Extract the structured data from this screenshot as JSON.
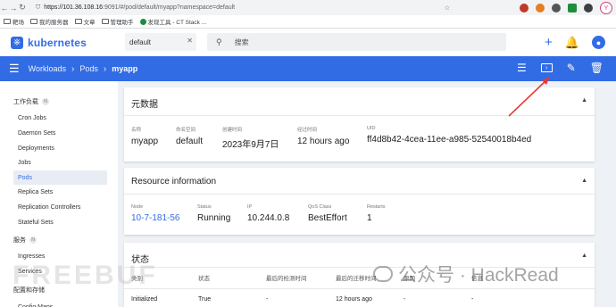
{
  "browser": {
    "url_host": "https://101.36.108.16",
    "url_rest": ":9091/#/pod/default/myapp?namespace=default",
    "bookmarks": [
      "靶场",
      "我的服务器",
      "文章",
      "管理助手",
      "发现工具 - CT Stack ..."
    ]
  },
  "header": {
    "brand": "kubernetes",
    "namespace": "default",
    "search_placeholder": "搜索"
  },
  "toolbar": {
    "crumbs": [
      "Workloads",
      "Pods",
      "myapp"
    ]
  },
  "sidebar": {
    "sections": [
      {
        "label": "工作负载",
        "badge": "N"
      },
      {
        "label": "服务",
        "badge": "N"
      },
      {
        "label": "配置和存储",
        "badge": ""
      }
    ],
    "items": [
      "Cron Jobs",
      "Daemon Sets",
      "Deployments",
      "Jobs",
      "Pods",
      "Replica Sets",
      "Replication Controllers",
      "Stateful Sets",
      "Ingresses",
      "Services",
      "Config Maps"
    ]
  },
  "metadata": {
    "title": "元数据",
    "fields": [
      {
        "label": "名称",
        "value": "myapp"
      },
      {
        "label": "命名空间",
        "value": "default"
      },
      {
        "label": "创建时间",
        "value": "2023年9月7日"
      },
      {
        "label": "经过时间",
        "value": "12 hours ago"
      },
      {
        "label": "UID",
        "value": "ff4d8b42-4cea-11ee-a985-52540018b4ed"
      }
    ]
  },
  "resource": {
    "title": "Resource information",
    "fields": [
      {
        "label": "Node",
        "value": "10-7-181-56"
      },
      {
        "label": "Status",
        "value": "Running"
      },
      {
        "label": "IP",
        "value": "10.244.0.8"
      },
      {
        "label": "QoS Class",
        "value": "BestEffort"
      },
      {
        "label": "Restarts",
        "value": "1"
      }
    ]
  },
  "conditions": {
    "title": "状态",
    "headers": [
      "类别",
      "状态",
      "最后的检测时间",
      "最后的迁移时间",
      "原因",
      "信息"
    ],
    "row": [
      "Initialized",
      "True",
      "-",
      "12 hours ago",
      "-",
      "-"
    ]
  },
  "watermarks": {
    "left": "FREEBUF",
    "right": "公众号 · HackRead"
  },
  "colors": {
    "accent": "#326ce5",
    "annotation": "#e53935"
  }
}
